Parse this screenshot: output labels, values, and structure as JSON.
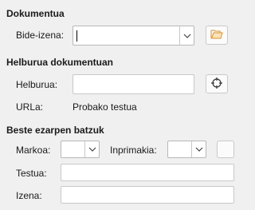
{
  "sections": {
    "document": "Dokumentua",
    "target": "Helburua dokumentuan",
    "other": "Beste ezarpen batzuk"
  },
  "document": {
    "path_label": "Bide-izena:",
    "path_value": ""
  },
  "target": {
    "target_label": "Helburua:",
    "target_value": "",
    "url_label": "URLa:",
    "url_value": "Probako testua"
  },
  "other": {
    "frame_label": "Markoa:",
    "frame_value": "",
    "form_label": "Inprimakia:",
    "form_value": "",
    "text_label": "Testua:",
    "text_value": "",
    "name_label": "Izena:",
    "name_value": ""
  },
  "icons": {
    "open_file": "folder-open-icon",
    "target": "crosshair-icon",
    "dropdown": "chevron-down-icon",
    "folder_color": "#e8a33a"
  }
}
